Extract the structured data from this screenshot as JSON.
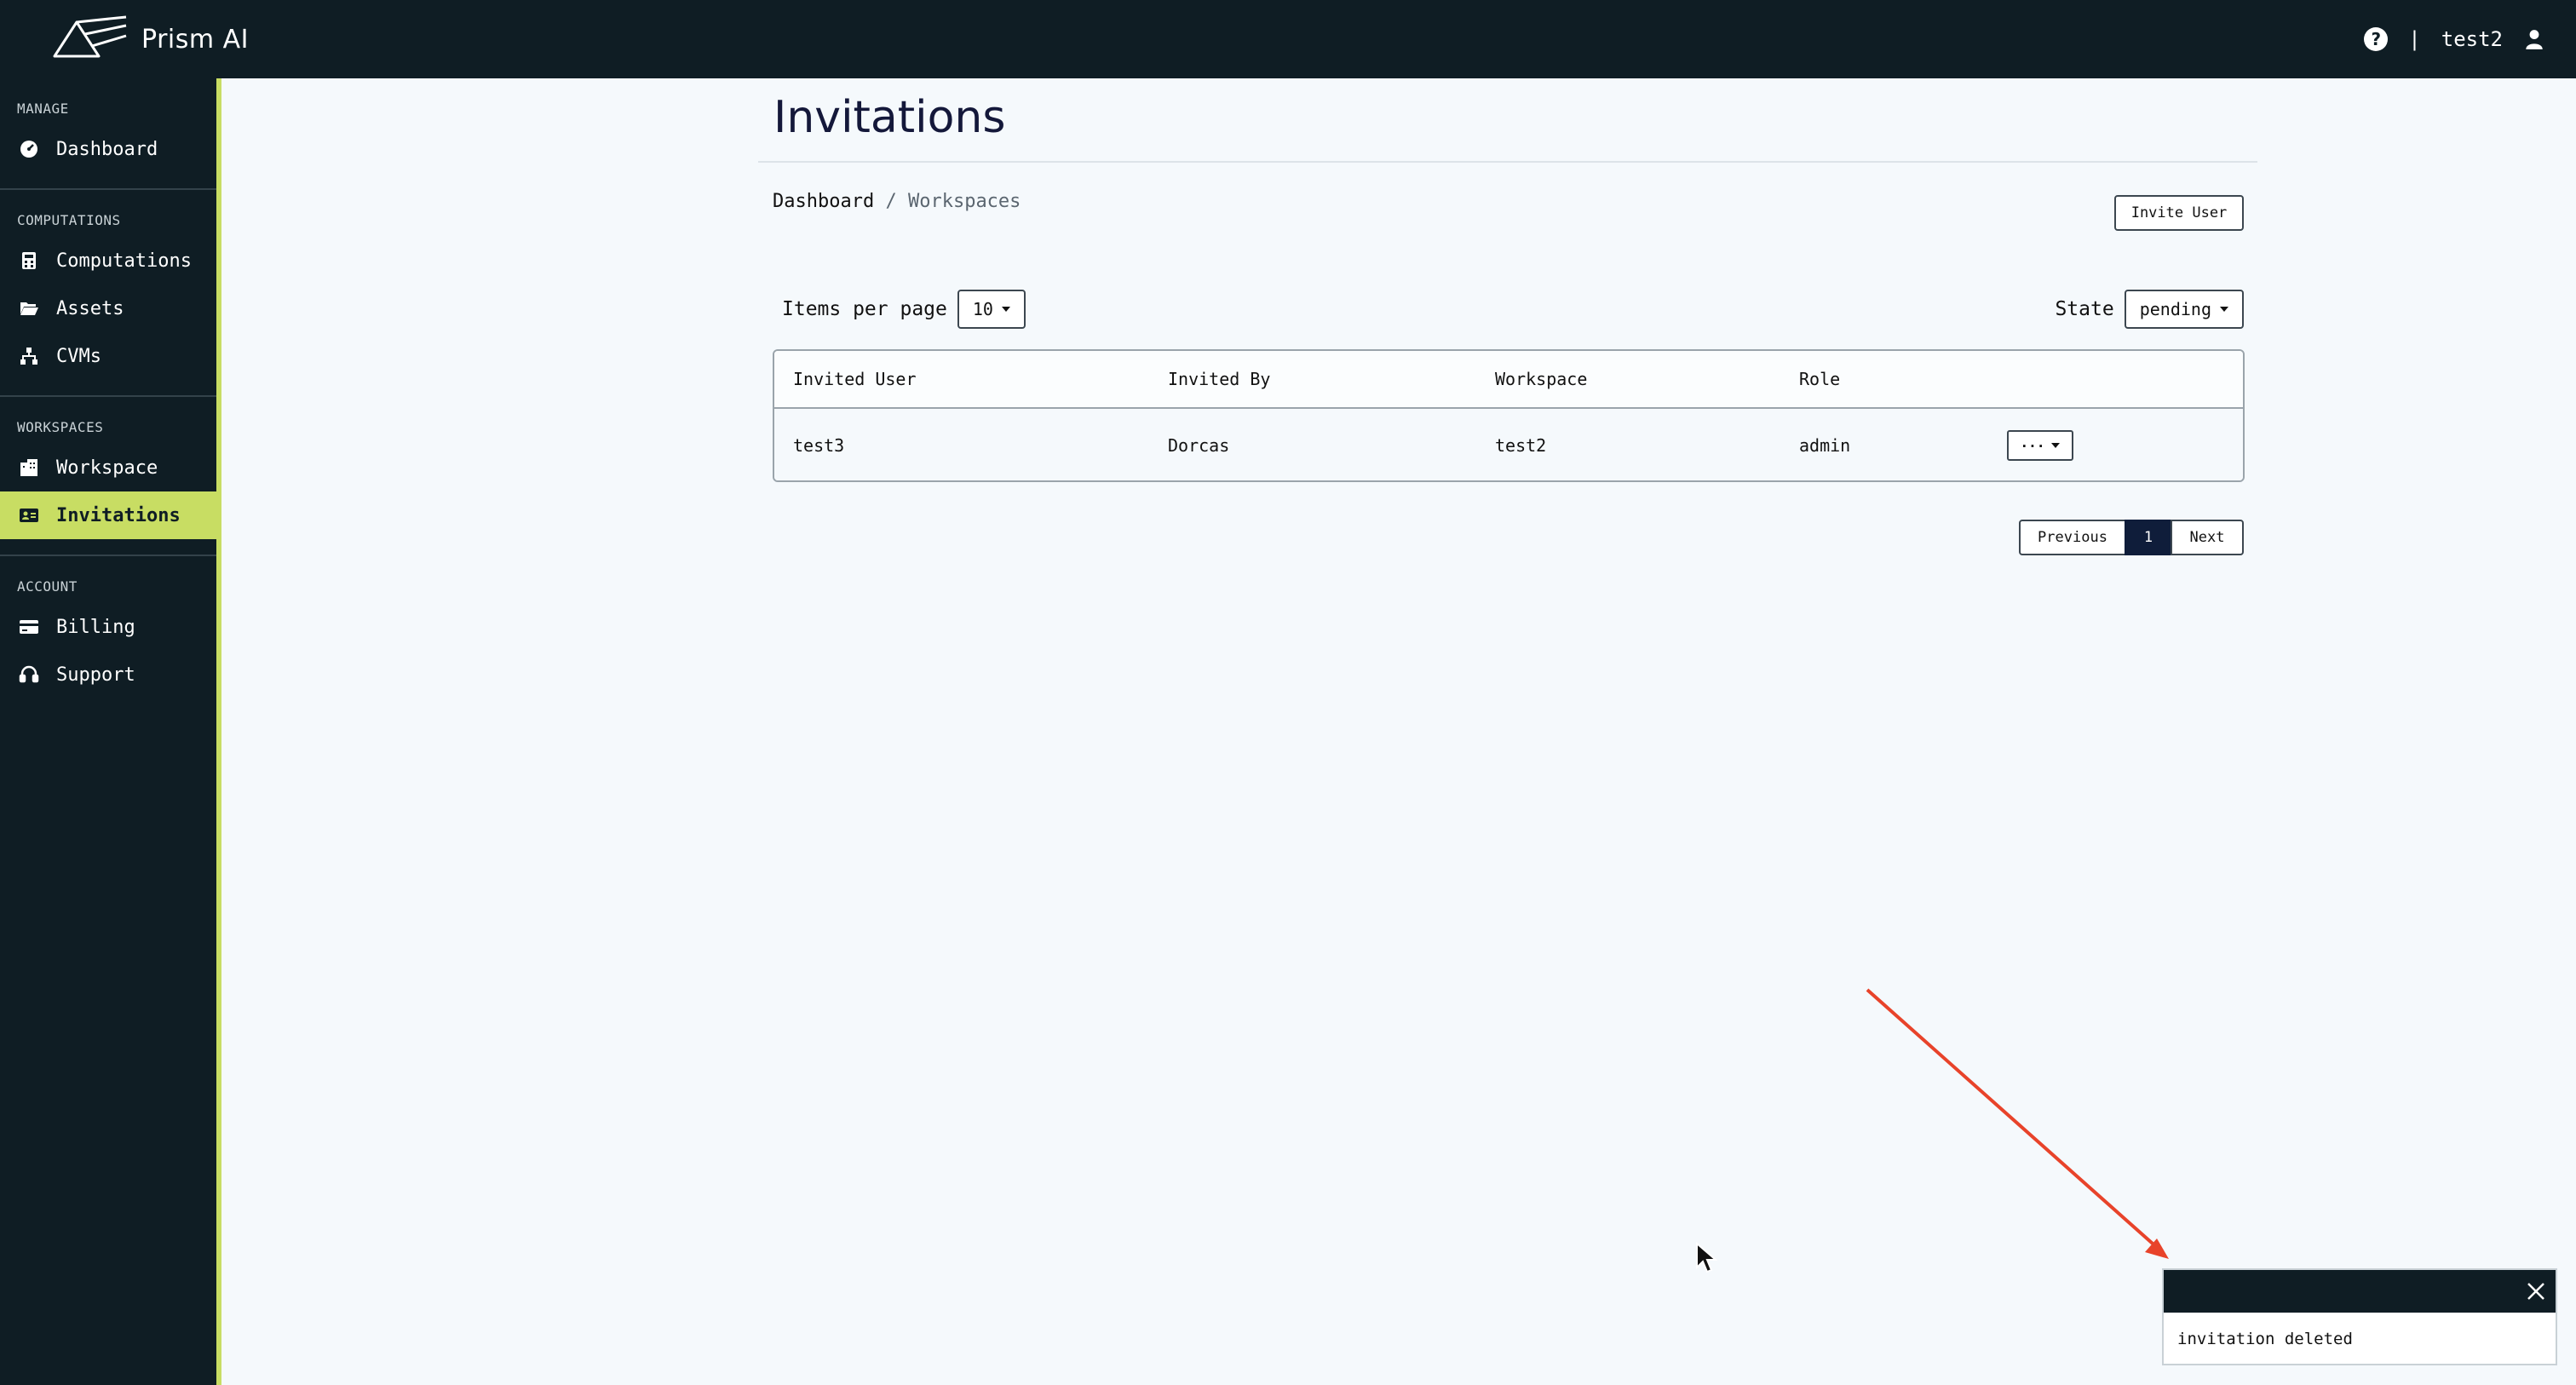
{
  "app": {
    "name": "Prism AI"
  },
  "header": {
    "help_icon": "?",
    "divider": "|",
    "username": "test2"
  },
  "sidebar": {
    "sections": [
      {
        "title": "MANAGE",
        "items": [
          {
            "label": "Dashboard",
            "icon": "dashboard-icon"
          }
        ]
      },
      {
        "title": "COMPUTATIONS",
        "items": [
          {
            "label": "Computations",
            "icon": "computations-icon"
          },
          {
            "label": "Assets",
            "icon": "folder-icon"
          },
          {
            "label": "CVMs",
            "icon": "network-icon"
          }
        ]
      },
      {
        "title": "WORKSPACES",
        "items": [
          {
            "label": "Workspace",
            "icon": "building-icon"
          },
          {
            "label": "Invitations",
            "icon": "id-card-icon",
            "active": true
          }
        ]
      },
      {
        "title": "ACCOUNT",
        "items": [
          {
            "label": "Billing",
            "icon": "credit-card-icon"
          },
          {
            "label": "Support",
            "icon": "headset-icon"
          }
        ]
      }
    ]
  },
  "main": {
    "title": "Invitations",
    "breadcrumb": {
      "root": "Dashboard",
      "separator": "/",
      "current": "Workspaces"
    },
    "invite_button": "Invite User",
    "items_per_page": {
      "label": "Items per page",
      "value": "10"
    },
    "state_filter": {
      "label": "State",
      "value": "pending"
    },
    "table": {
      "columns": [
        "Invited User",
        "Invited By",
        "Workspace",
        "Role"
      ],
      "rows": [
        {
          "invited_user": "test3",
          "invited_by": "Dorcas",
          "workspace": "test2",
          "role": "admin",
          "actions": "···"
        }
      ]
    },
    "pagination": {
      "previous": "Previous",
      "page": "1",
      "next": "Next"
    }
  },
  "toast": {
    "message": "invitation deleted"
  },
  "colors": {
    "sidebar_bg": "#0f1d24",
    "accent": "#c8dd63",
    "page_bg": "#f5f9fc",
    "annotation_arrow": "#e8432a"
  }
}
